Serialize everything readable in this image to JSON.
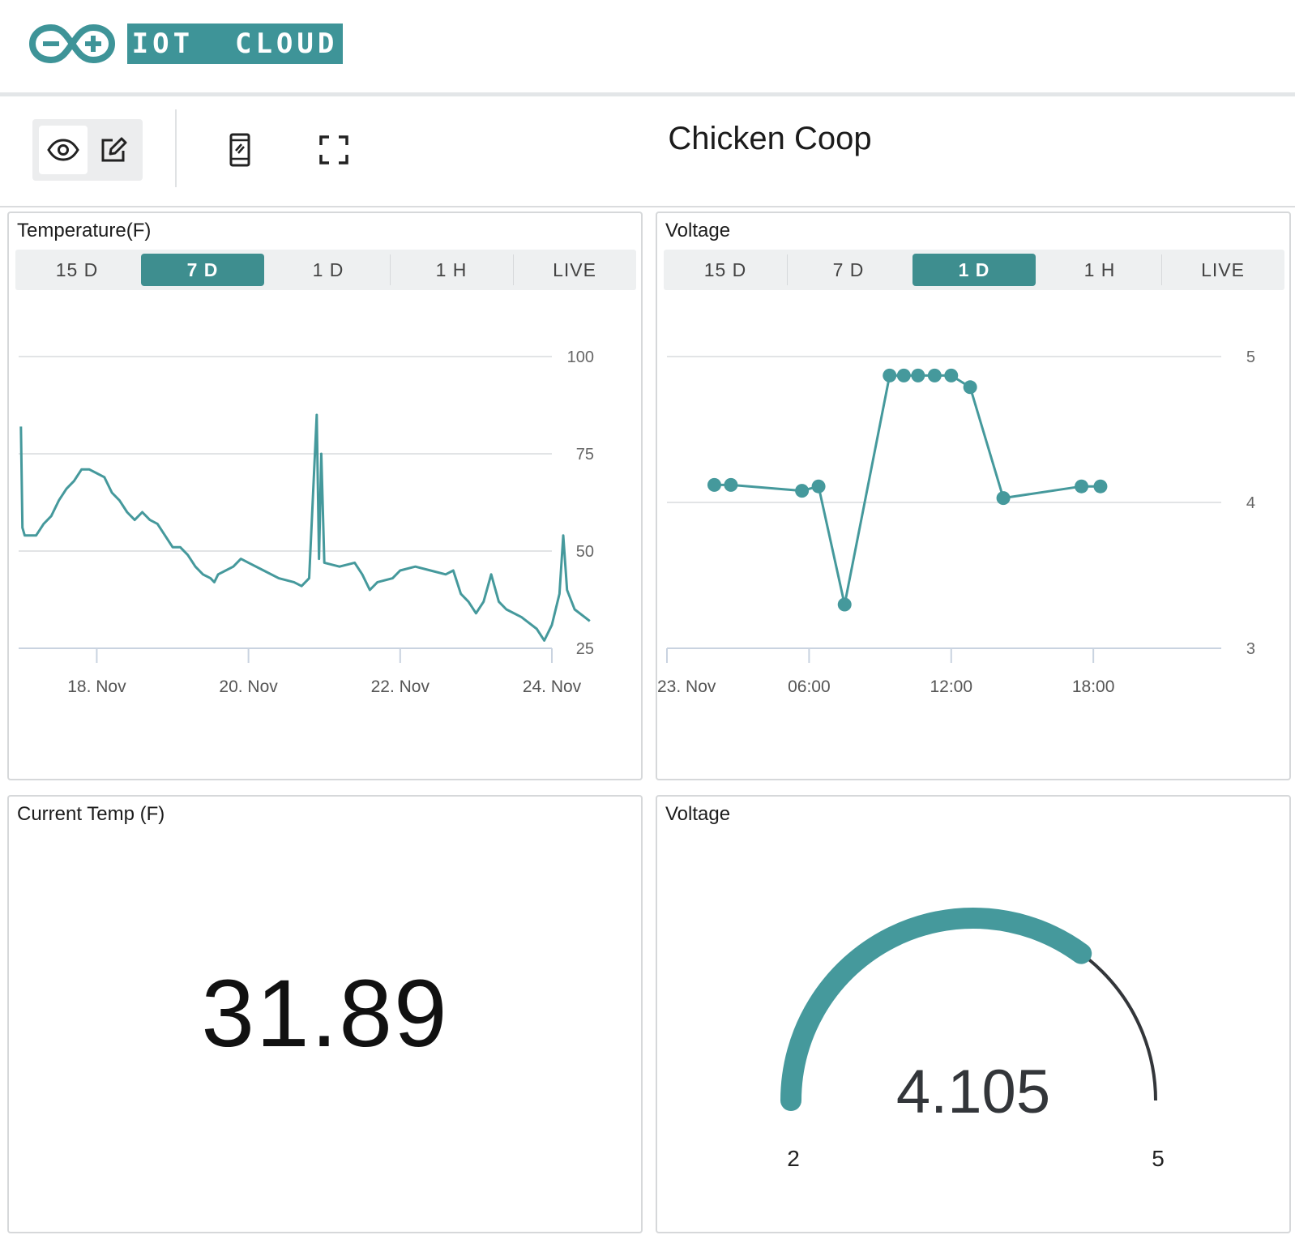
{
  "brand": {
    "name": "IOT  CLOUD"
  },
  "toolbar": {
    "dashboard_title": "Chicken Coop"
  },
  "colors": {
    "accent": "#3e9498",
    "active_tab": "#3e8e8f",
    "line": "#45999c",
    "gauge_track": "#33363a"
  },
  "icons": [
    "eye-icon",
    "edit-pencil-icon",
    "mobile-phone-icon",
    "fullscreen-icon"
  ],
  "widgets": {
    "temp_chart": {
      "title": "Temperature(F)",
      "ranges": [
        "15 D",
        "7 D",
        "1 D",
        "1 H",
        "LIVE"
      ],
      "active_range": "7 D"
    },
    "voltage_chart": {
      "title": "Voltage",
      "ranges": [
        "15 D",
        "7 D",
        "1 D",
        "1 H",
        "LIVE"
      ],
      "active_range": "1 D"
    },
    "current_temp": {
      "title": "Current Temp (F)",
      "value": "31.89"
    },
    "voltage_gauge": {
      "title": "Voltage",
      "value": "4.105",
      "min_label": "2",
      "max_label": "5",
      "min": 2,
      "max": 5,
      "reading": 4.105
    }
  },
  "chart_data": [
    {
      "type": "line",
      "title": "",
      "series": [
        {
          "values": [
            [
              17.0,
              82
            ],
            [
              17.02,
              56
            ],
            [
              17.05,
              54
            ],
            [
              17.1,
              54
            ],
            [
              17.2,
              54
            ],
            [
              17.3,
              57
            ],
            [
              17.4,
              59
            ],
            [
              17.5,
              63
            ],
            [
              17.6,
              66
            ],
            [
              17.7,
              68
            ],
            [
              17.8,
              71
            ],
            [
              17.9,
              71
            ],
            [
              18.0,
              70
            ],
            [
              18.1,
              69
            ],
            [
              18.2,
              65
            ],
            [
              18.3,
              63
            ],
            [
              18.4,
              60
            ],
            [
              18.5,
              58
            ],
            [
              18.6,
              60
            ],
            [
              18.7,
              58
            ],
            [
              18.8,
              57
            ],
            [
              18.9,
              54
            ],
            [
              19.0,
              51
            ],
            [
              19.1,
              51
            ],
            [
              19.2,
              49
            ],
            [
              19.3,
              46
            ],
            [
              19.4,
              44
            ],
            [
              19.5,
              43
            ],
            [
              19.55,
              42
            ],
            [
              19.6,
              44
            ],
            [
              19.7,
              45
            ],
            [
              19.8,
              46
            ],
            [
              19.9,
              48
            ],
            [
              20.0,
              47
            ],
            [
              20.2,
              45
            ],
            [
              20.4,
              43
            ],
            [
              20.6,
              42
            ],
            [
              20.7,
              41
            ],
            [
              20.8,
              43
            ],
            [
              20.9,
              85
            ],
            [
              20.93,
              48
            ],
            [
              20.96,
              75
            ],
            [
              21.0,
              47
            ],
            [
              21.2,
              46
            ],
            [
              21.4,
              47
            ],
            [
              21.5,
              44
            ],
            [
              21.6,
              40
            ],
            [
              21.7,
              42
            ],
            [
              21.9,
              43
            ],
            [
              22.0,
              45
            ],
            [
              22.2,
              46
            ],
            [
              22.4,
              45
            ],
            [
              22.6,
              44
            ],
            [
              22.7,
              45
            ],
            [
              22.8,
              39
            ],
            [
              22.9,
              37
            ],
            [
              23.0,
              34
            ],
            [
              23.1,
              37
            ],
            [
              23.2,
              44
            ],
            [
              23.3,
              37
            ],
            [
              23.4,
              35
            ],
            [
              23.6,
              33
            ],
            [
              23.8,
              30
            ],
            [
              23.9,
              27
            ],
            [
              24.0,
              31
            ],
            [
              24.1,
              39
            ],
            [
              24.15,
              54
            ],
            [
              24.2,
              40
            ],
            [
              24.3,
              35
            ],
            [
              24.5,
              32
            ]
          ]
        }
      ],
      "x_tick_labels": [
        "18. Nov",
        "20. Nov",
        "22. Nov",
        "24. Nov"
      ],
      "x_ticks": [
        18,
        20,
        22,
        24
      ],
      "y_ticks": [
        25,
        50,
        75,
        100
      ],
      "xlim": [
        16.97,
        24.0
      ],
      "ylim": [
        25,
        100
      ],
      "grid": true,
      "y_axis_side": "right"
    },
    {
      "type": "line",
      "title": "",
      "series": [
        {
          "values": [
            [
              2.0,
              4.12
            ],
            [
              2.7,
              4.12
            ],
            [
              5.7,
              4.08
            ],
            [
              6.4,
              4.11
            ],
            [
              7.5,
              3.3
            ],
            [
              9.4,
              4.87
            ],
            [
              10.0,
              4.87
            ],
            [
              10.6,
              4.87
            ],
            [
              11.3,
              4.87
            ],
            [
              12.0,
              4.87
            ],
            [
              12.8,
              4.79
            ],
            [
              14.2,
              4.03
            ],
            [
              17.5,
              4.11
            ],
            [
              18.3,
              4.11
            ]
          ]
        }
      ],
      "markers": true,
      "x_tick_labels": [
        "23. Nov",
        "06:00",
        "12:00",
        "18:00"
      ],
      "x_ticks": [
        0,
        6,
        12,
        18
      ],
      "y_ticks": [
        3,
        4,
        5
      ],
      "xlim": [
        0,
        23.4
      ],
      "ylim": [
        3,
        5
      ],
      "grid": true,
      "y_axis_side": "right"
    }
  ]
}
